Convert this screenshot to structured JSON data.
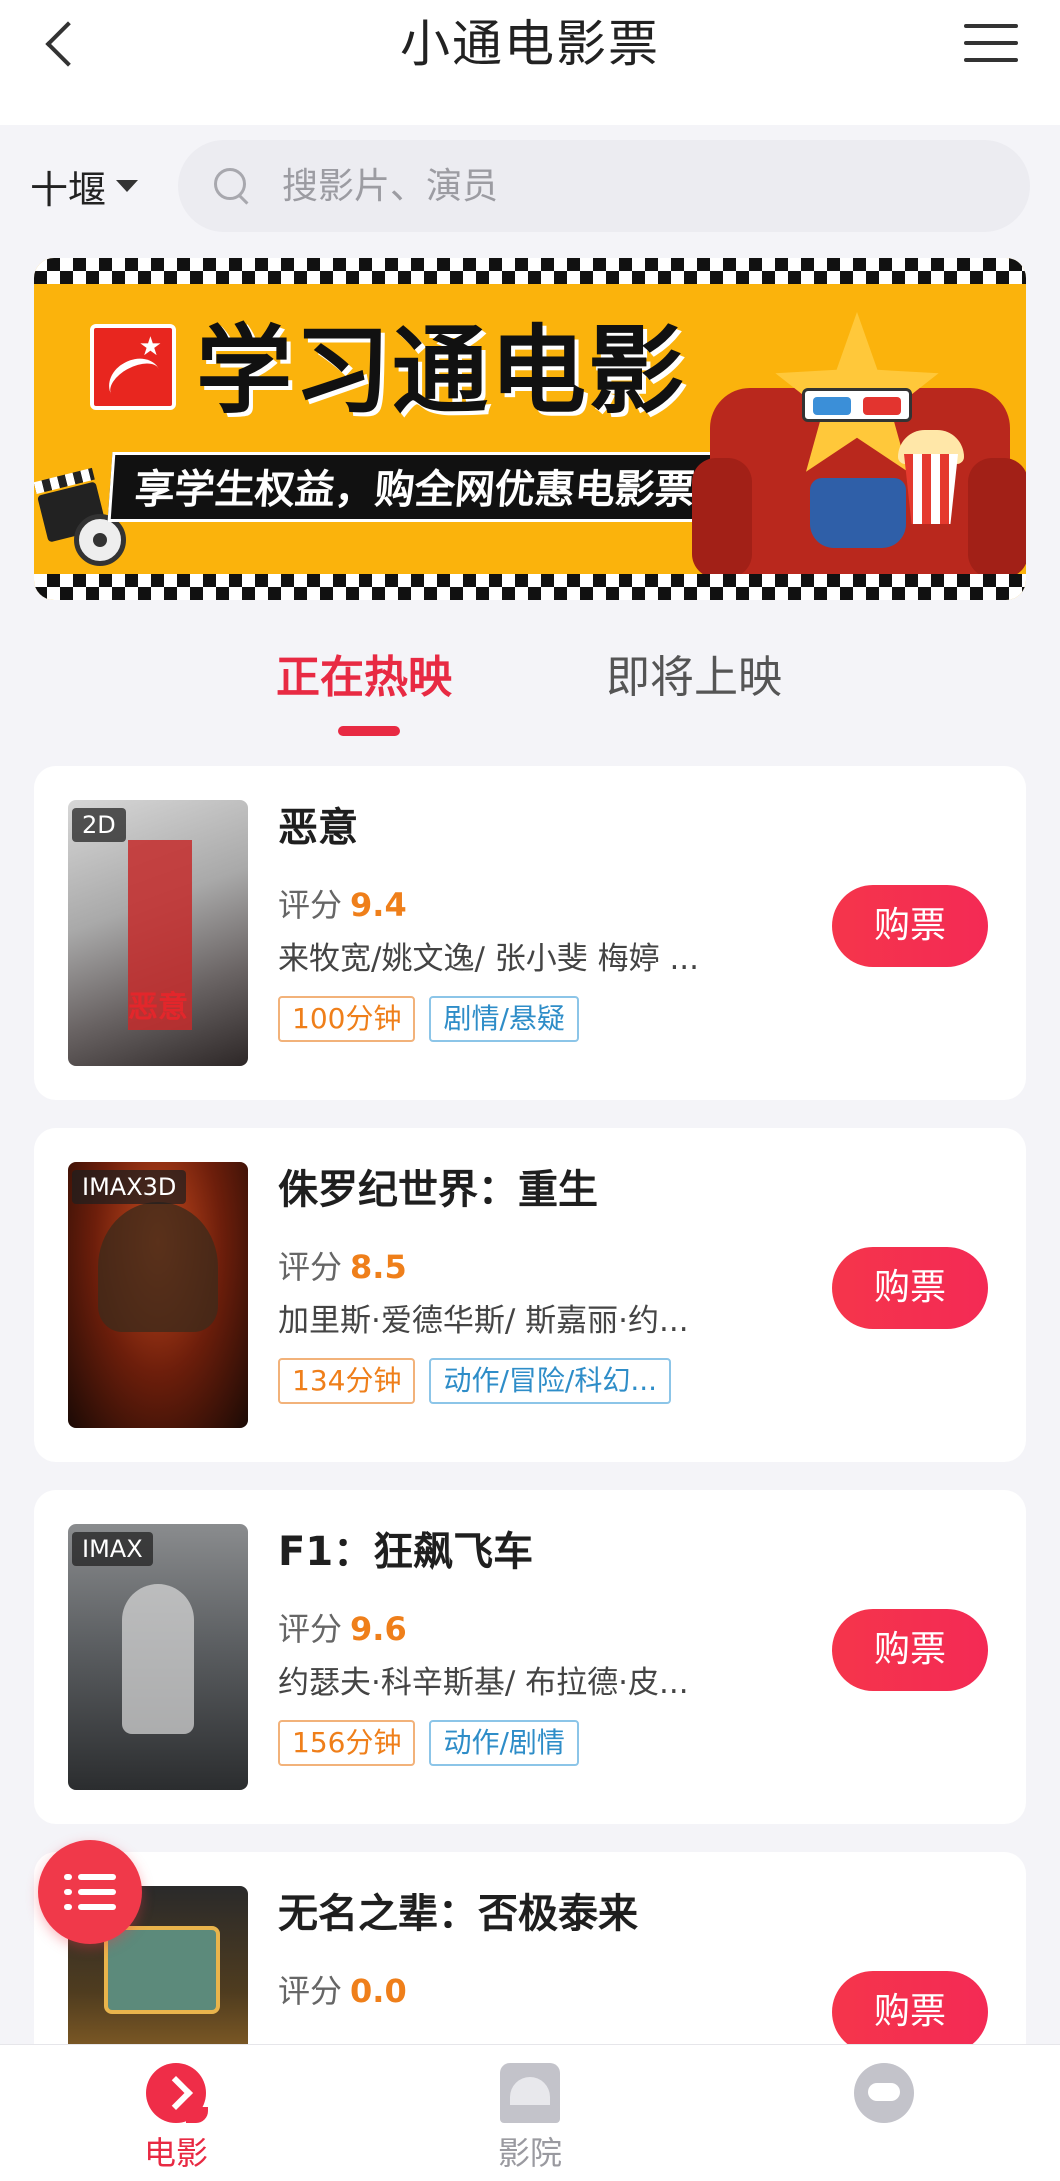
{
  "header": {
    "title": "小通电影票",
    "back_icon": "chevron-left-icon",
    "menu_icon": "hamburger-menu-icon"
  },
  "search": {
    "city": "十堰",
    "placeholder": "搜影片、演员"
  },
  "banner": {
    "brand": "学习通电影",
    "slogan": "享学生权益，购全网优惠电影票"
  },
  "tabs": {
    "now_showing": "正在热映",
    "coming_soon": "即将上映"
  },
  "movies": [
    {
      "format": "2D",
      "poster_text": "恶意",
      "title": "恶意",
      "rating_label": "评分",
      "score": "9.4",
      "cast": "来牧宽/姚文逸/ 张小斐 梅婷 ...",
      "duration": "100分钟",
      "genre": "剧情/悬疑",
      "buy_label": "购票"
    },
    {
      "format": "IMAX3D",
      "poster_text": "",
      "title": "侏罗纪世界：重生",
      "rating_label": "评分",
      "score": "8.5",
      "cast": "加里斯·爱德华斯/ 斯嘉丽·约...",
      "duration": "134分钟",
      "genre": "动作/冒险/科幻...",
      "buy_label": "购票"
    },
    {
      "format": "IMAX",
      "poster_text": "",
      "title": "F1：狂飙飞车",
      "rating_label": "评分",
      "score": "9.6",
      "cast": "约瑟夫·科辛斯基/ 布拉德·皮...",
      "duration": "156分钟",
      "genre": "动作/剧情",
      "buy_label": "购票"
    },
    {
      "format": "",
      "poster_text": "",
      "title": "无名之辈：否极泰来",
      "rating_label": "评分",
      "score": "0.0",
      "buy_label": "购票"
    }
  ],
  "bottom_nav": {
    "movie": "电影",
    "cinema": "影院",
    "movie_icon": "movie-tab-icon",
    "cinema_icon": "cinema-tab-icon",
    "me_icon": "profile-tab-icon"
  },
  "colors": {
    "accent": "#e82a43",
    "score": "#ef7f1a",
    "genre": "#2e8dc8",
    "banner": "#fbb30c"
  }
}
